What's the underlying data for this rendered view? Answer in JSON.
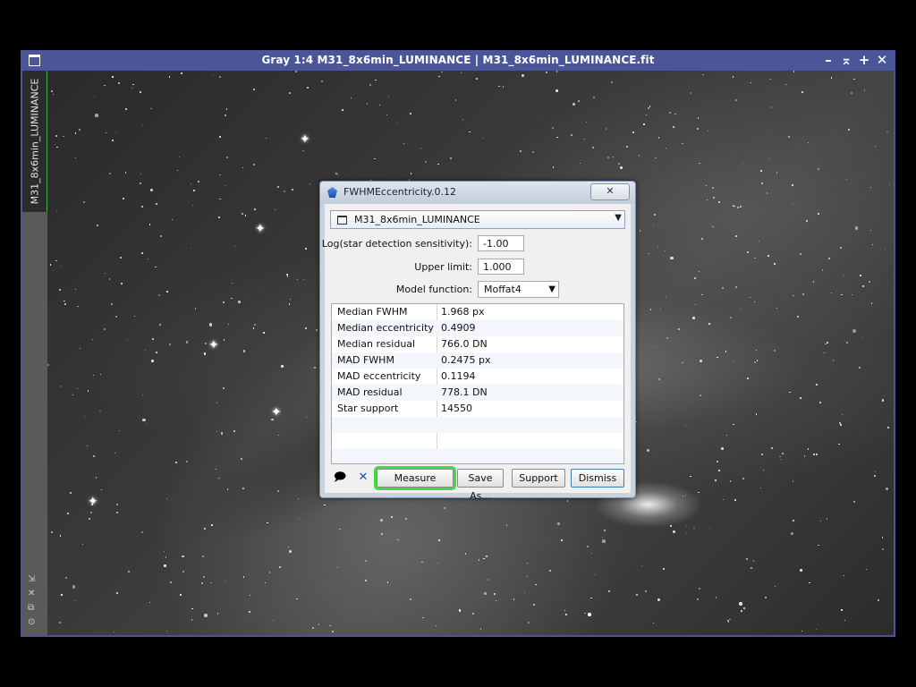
{
  "window": {
    "title": "Gray 1:4 M31_8x6min_LUMINANCE | M31_8x6min_LUMINANCE.fit",
    "buttons": [
      "–",
      "⌅",
      "+",
      "✕"
    ],
    "side_tab_label": "M31_8x6min_LUMINANCE",
    "side_icons": [
      "⇲",
      "✕",
      "⧉",
      "⊙"
    ]
  },
  "dialog": {
    "title": "FWHMEccentricity.0.12",
    "close_glyph": "✕",
    "image_selector": "M31_8x6min_LUMINANCE",
    "fields": {
      "sensitivity_label": "Log(star detection sensitivity):",
      "sensitivity_value": "-1.00",
      "upper_limit_label": "Upper limit:",
      "upper_limit_value": "1.000",
      "model_label": "Model function:",
      "model_value": "Moffat4"
    },
    "results": [
      {
        "key": "Median FWHM",
        "value": "1.968 px"
      },
      {
        "key": "Median eccentricity",
        "value": "0.4909"
      },
      {
        "key": "Median residual",
        "value": "766.0 DN"
      },
      {
        "key": "MAD FWHM",
        "value": "0.2475 px"
      },
      {
        "key": "MAD eccentricity",
        "value": "0.1194"
      },
      {
        "key": "MAD residual",
        "value": "778.1 DN"
      },
      {
        "key": "Star support",
        "value": "14550"
      }
    ],
    "buttons": {
      "measure": "Measure",
      "save_as": "Save As...",
      "support": "Support",
      "dismiss": "Dismiss"
    }
  },
  "colors": {
    "window_frame": "#4b5698",
    "highlight": "#3fdc3f",
    "active_tab_accent": "#3fae4d"
  }
}
